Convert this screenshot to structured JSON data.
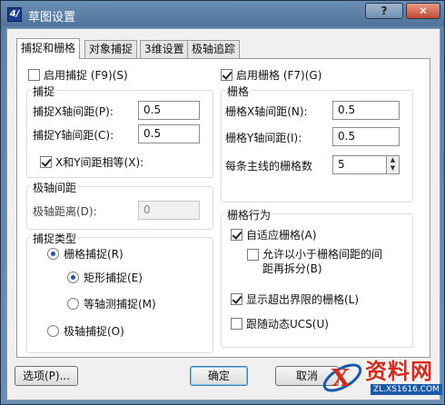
{
  "window": {
    "title": "草图设置",
    "app_icon_glyph": "4/",
    "help_glyph": "?",
    "close_glyph": "✕"
  },
  "tabs": [
    {
      "label": "捕捉和栅格",
      "active": true
    },
    {
      "label": "对象捕捉",
      "active": false
    },
    {
      "label": "3维设置",
      "active": false
    },
    {
      "label": "极轴追踪",
      "active": false
    }
  ],
  "snap": {
    "enable_label": "启用捕捉 (F9)(S)",
    "enabled": false,
    "group_title": "捕捉",
    "x_spacing_label": "捕捉X轴间距(P):",
    "x_spacing_value": "0.5",
    "y_spacing_label": "捕捉Y轴间距(C):",
    "y_spacing_value": "0.5",
    "equal_label": "X和Y间距相等(X):",
    "equal_checked": true
  },
  "polar": {
    "group_title": "极轴间距",
    "distance_label": "极轴距离(D):",
    "distance_value": "0"
  },
  "snap_type": {
    "group_title": "捕捉类型",
    "grid_snap_label": "栅格捕捉(R)",
    "rect_snap_label": "矩形捕捉(E)",
    "iso_snap_label": "等轴测捕捉(M)",
    "polar_snap_label": "极轴捕捉(O)",
    "selected": "grid_snap",
    "sub_selected": "rect_snap"
  },
  "grid": {
    "enable_label": "启用栅格 (F7)(G)",
    "enabled": true,
    "group_title": "栅格",
    "x_spacing_label": "栅格X轴间距(N):",
    "x_spacing_value": "0.5",
    "y_spacing_label": "栅格Y轴间距(I):",
    "y_spacing_value": "0.5",
    "major_label": "每条主线的栅格数",
    "major_value": "5"
  },
  "grid_behavior": {
    "group_title": "栅格行为",
    "adaptive_label": "自适应栅格(A)",
    "adaptive_checked": true,
    "subdivide_label_line1": "允许以小于栅格间距的间",
    "subdivide_label_line2": "距再拆分(B)",
    "subdivide_checked": false,
    "beyond_limits_label": "显示超出界限的栅格(L)",
    "beyond_limits_checked": true,
    "follow_ucs_label": "跟随动态UCS(U)",
    "follow_ucs_checked": false
  },
  "footer": {
    "options_label": "选项(P)...",
    "ok_label": "确定",
    "cancel_label": "取消"
  },
  "watermark": {
    "main": "资料网",
    "url": "ZL.XS1616.COM"
  }
}
